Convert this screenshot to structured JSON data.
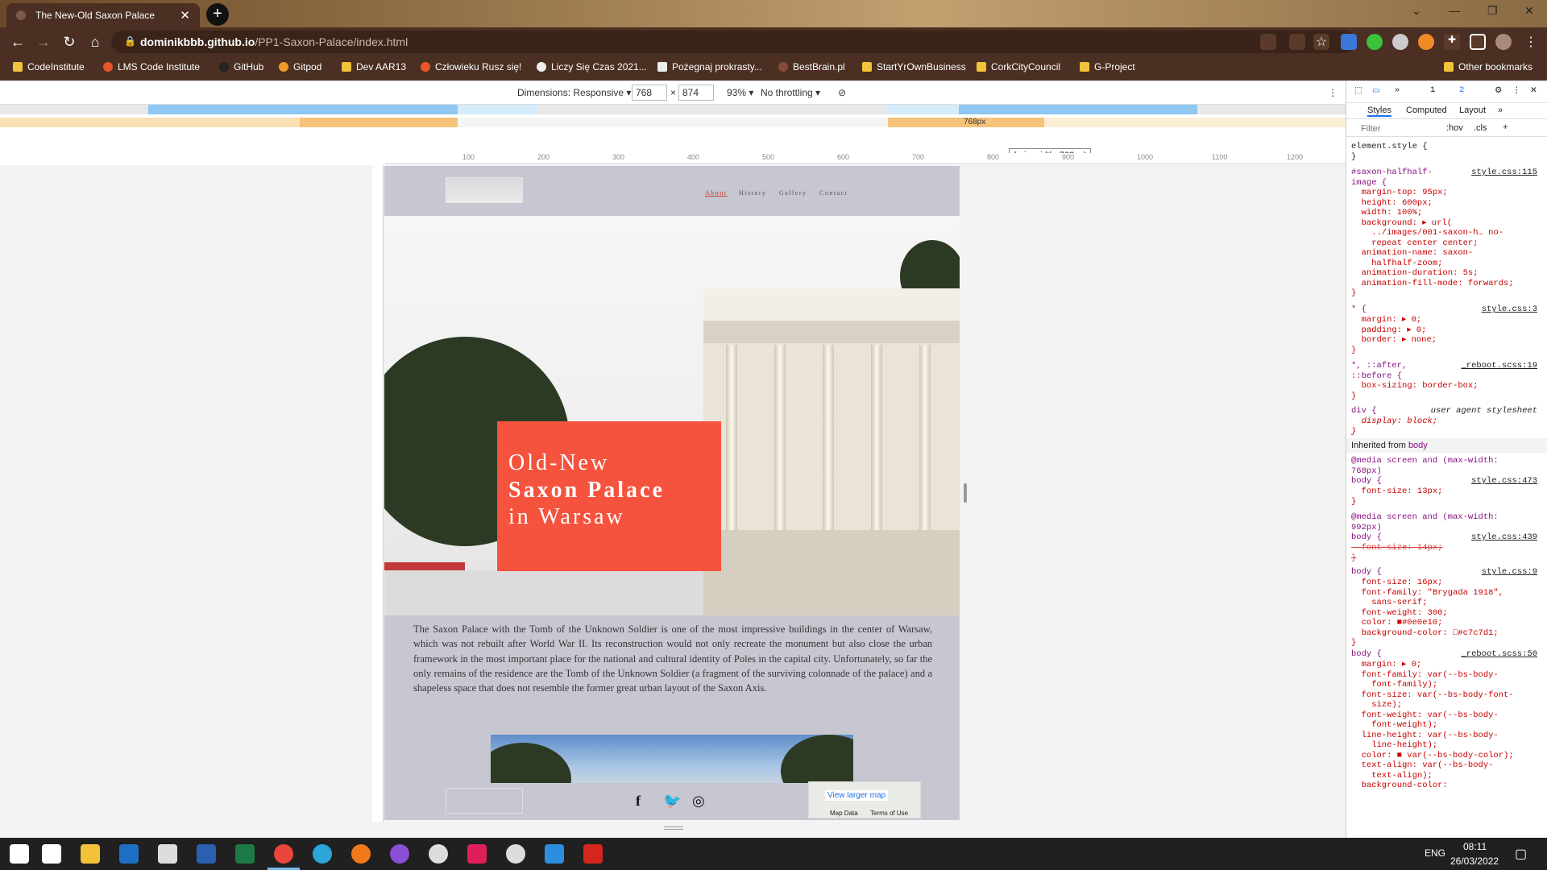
{
  "browser": {
    "tab_title": "The New-Old Saxon Palace",
    "tab_close": "✕",
    "new_tab": "+",
    "url_host": "dominikbbb.github.io",
    "url_path": "/PP1-Saxon-Palace/index.html",
    "window_controls": [
      "⌄",
      "—",
      "❐",
      "✕"
    ]
  },
  "bookmarks": [
    {
      "label": "CodeInstitute",
      "color": "#f2c23a"
    },
    {
      "label": "LMS Code Institute",
      "color": "#e8562a"
    },
    {
      "label": "GitHub",
      "color": "#222222"
    },
    {
      "label": "Gitpod",
      "color": "#f09a2c"
    },
    {
      "label": "Dev AAR13",
      "color": "#f2c23a"
    },
    {
      "label": "Człowieku Rusz się!",
      "color": "#e8562a"
    },
    {
      "label": "Liczy Się Czas 2021...",
      "color": "#eeeeee"
    },
    {
      "label": "Pożegnaj prokrasty...",
      "color": "#eeeeee"
    },
    {
      "label": "BestBrain.pl",
      "color": "#8a4a3a"
    },
    {
      "label": "StartYrOwnBusiness",
      "color": "#f2c23a"
    },
    {
      "label": "CorkCityCouncil",
      "color": "#f2c23a"
    },
    {
      "label": "G-Project",
      "color": "#f2c23a"
    }
  ],
  "other_bookmarks": "Other bookmarks",
  "device_toolbar": {
    "dimensions_label": "Dimensions: Responsive ▾",
    "width": "768",
    "height": "874",
    "times": "×",
    "zoom": "93% ▾",
    "throttling": "No throttling ▾",
    "media_label": "768px",
    "tooltip": "(min-width: 768px)"
  },
  "ruler_labels": [
    "100",
    "200",
    "300",
    "400",
    "500",
    "600",
    "700",
    "800",
    "900",
    "1000",
    "1100",
    "1200"
  ],
  "site": {
    "nav": [
      "About",
      "History",
      "Gallery",
      "Contact"
    ],
    "hero_line1": "Old-New",
    "hero_line2": "Saxon Palace",
    "hero_line3": "in Warsaw",
    "intro": "The Saxon Palace with the Tomb of the Unknown Soldier is one of the most impressive buildings in the center of Warsaw, which was not rebuilt after World War II. Its reconstruction would not only recreate the monument but also close the urban framework in the most important place for the national and cultural identity of Poles in the capital city. Unfortunately, so far the only remains of the residence are the Tomb of the Unknown Soldier (a fragment of the surviving colonnade of the palace) and a shapeless space that does not resemble the former great urban layout of the Saxon Axis.",
    "social": [
      "f",
      "🐦",
      "◎"
    ],
    "map_link": "View larger map",
    "map_data": "Map Data",
    "map_terms": "Terms of Use"
  },
  "devtools": {
    "tabs": [
      "Styles",
      "Computed",
      "Layout",
      "»"
    ],
    "filter_placeholder": "Filter",
    "hov": ":hov",
    "cls": ".cls",
    "plus": "+",
    "badge1": "1",
    "badge2": "2",
    "element_style": "element.style {\n}",
    "rule1_sel": "#saxon-halfhalf-\nimage {",
    "rule1_src": "style.css:115",
    "rule1_body": "  margin-top: 95px;\n  height: 600px;\n  width: 100%;\n  background: ▸ url(\n    ../images/001-saxon-h… no-\n    repeat center center;\n  animation-name: saxon-\n    halfhalf-zoom;\n  animation-duration: 5s;\n  animation-fill-mode: forwards;\n}",
    "rule2_sel": "* {",
    "rule2_src": "style.css:3",
    "rule2_body": "  margin: ▸ 0;\n  padding: ▸ 0;\n  border: ▸ none;\n}",
    "rule3_sel": "*, ::after,\n::before {",
    "rule3_src": "_reboot.scss:19",
    "rule3_body": "  box-sizing: border-box;\n}",
    "rule4_sel": "div {",
    "rule4_src": "user agent stylesheet",
    "rule4_body": "  display: block;\n}",
    "inherited": "Inherited from",
    "inherited_el": "body",
    "rule5_sel": "@media screen and (max-width:\n768px)\nbody {",
    "rule5_src": "style.css:473",
    "rule5_body": "  font-size: 13px;\n}",
    "rule6_sel": "@media screen and (max-width:\n992px)\nbody {",
    "rule6_src": "style.css:439",
    "rule6_body": "  font-size: 14px;\n}",
    "rule7_sel": "body {",
    "rule7_src": "style.css:9",
    "rule7_body": "  font-size: 16px;\n  font-family: \"Brygada 1918\",\n    sans-serif;\n  font-weight: 300;\n  color: ■#0e0e10;\n  background-color: □#c7c7d1;\n}",
    "rule8_sel": "body {",
    "rule8_src": "_reboot.scss:50",
    "rule8_body": "  margin: ▸ 0;\n  font-family: var(--bs-body-\n    font-family);\n  font-size: var(--bs-body-font-\n    size);\n  font-weight: var(--bs-body-\n    font-weight);\n  line-height: var(--bs-body-\n    line-height);\n  color: ■ var(--bs-body-color);\n  text-align: var(--bs-body-\n    text-align);\n  background-color:"
  },
  "taskbar": {
    "lang": "ENG",
    "time": "08:11",
    "date": "26/03/2022",
    "apps": [
      {
        "name": "windows-start",
        "color": "#ffffff"
      },
      {
        "name": "home",
        "color": "#ffffff"
      },
      {
        "name": "file-explorer",
        "color": "#f2c23a"
      },
      {
        "name": "outlook",
        "color": "#1e6fc4"
      },
      {
        "name": "mail",
        "color": "#dddddd"
      },
      {
        "name": "word",
        "color": "#2b5fb0"
      },
      {
        "name": "excel",
        "color": "#1e7a44"
      },
      {
        "name": "chrome",
        "color": "#e8453c"
      },
      {
        "name": "edge",
        "color": "#2aa6d9"
      },
      {
        "name": "firefox",
        "color": "#f07a1a"
      },
      {
        "name": "github-desktop",
        "color": "#8a4fd3"
      },
      {
        "name": "speedometer",
        "color": "#dddddd"
      },
      {
        "name": "slack",
        "color": "#e01e5a"
      },
      {
        "name": "emoji",
        "color": "#dddddd"
      },
      {
        "name": "vscode",
        "color": "#2d8ee0"
      },
      {
        "name": "acrobat",
        "color": "#d4261c"
      }
    ]
  }
}
